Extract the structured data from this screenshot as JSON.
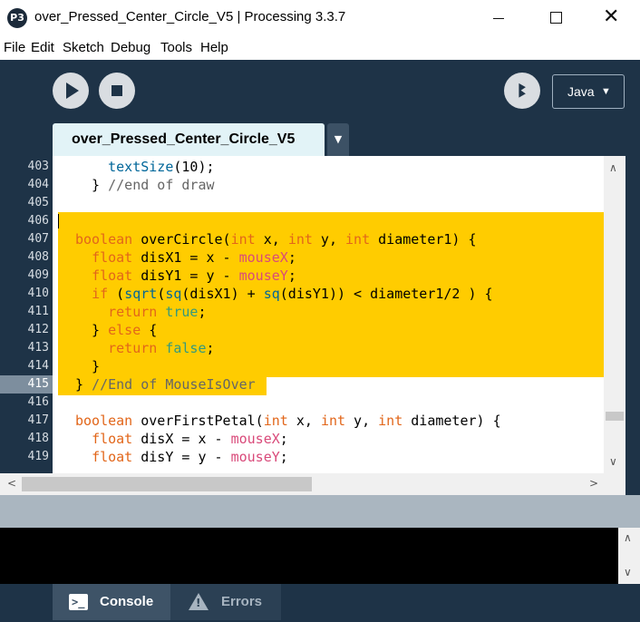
{
  "window": {
    "title": "over_Pressed_Center_Circle_V5 | Processing 3.3.7",
    "app_icon_text": "P3",
    "close_symbol": "✕"
  },
  "menu": {
    "items": [
      {
        "label": "File"
      },
      {
        "label": "Edit"
      },
      {
        "label": "Sketch"
      },
      {
        "label": "Debug"
      },
      {
        "label": "Tools"
      },
      {
        "label": "Help"
      }
    ]
  },
  "toolbar": {
    "run_icon": "play-icon",
    "stop_icon": "stop-icon",
    "debug_icon": "butterfly-debugger-icon",
    "debug_glyph": "ꔪ",
    "mode_label": "Java",
    "mode_arrow": "▼"
  },
  "tabs": {
    "active_label": "over_Pressed_Center_Circle_V5",
    "menu_arrow": "▼"
  },
  "editor": {
    "current_line": "415",
    "lines": [
      {
        "num": "403",
        "tokens": [
          {
            "t": "    ",
            "c": "plain"
          },
          {
            "t": "textSize",
            "c": "fn"
          },
          {
            "t": "(10);",
            "c": "plain"
          }
        ]
      },
      {
        "num": "404",
        "tokens": [
          {
            "t": "  } ",
            "c": "plain"
          },
          {
            "t": "//end of draw",
            "c": "cmt"
          }
        ]
      },
      {
        "num": "405",
        "tokens": []
      },
      {
        "num": "406",
        "tokens": []
      },
      {
        "num": "407",
        "tokens": [
          {
            "t": "boolean",
            "c": "kw"
          },
          {
            "t": " overCircle(",
            "c": "plain"
          },
          {
            "t": "int",
            "c": "kw"
          },
          {
            "t": " x, ",
            "c": "plain"
          },
          {
            "t": "int",
            "c": "kw"
          },
          {
            "t": " y, ",
            "c": "plain"
          },
          {
            "t": "int",
            "c": "kw"
          },
          {
            "t": " diameter1) {",
            "c": "plain"
          }
        ]
      },
      {
        "num": "408",
        "tokens": [
          {
            "t": "  ",
            "c": "plain"
          },
          {
            "t": "float",
            "c": "kw"
          },
          {
            "t": " disX1 = x - ",
            "c": "plain"
          },
          {
            "t": "mouseX",
            "c": "var"
          },
          {
            "t": ";",
            "c": "plain"
          }
        ]
      },
      {
        "num": "409",
        "tokens": [
          {
            "t": "  ",
            "c": "plain"
          },
          {
            "t": "float",
            "c": "kw"
          },
          {
            "t": " disY1 = y - ",
            "c": "plain"
          },
          {
            "t": "mouseY",
            "c": "var"
          },
          {
            "t": ";",
            "c": "plain"
          }
        ]
      },
      {
        "num": "410",
        "tokens": [
          {
            "t": "  ",
            "c": "plain"
          },
          {
            "t": "if",
            "c": "kw"
          },
          {
            "t": " (",
            "c": "plain"
          },
          {
            "t": "sqrt",
            "c": "fn"
          },
          {
            "t": "(",
            "c": "plain"
          },
          {
            "t": "sq",
            "c": "fn"
          },
          {
            "t": "(disX1) + ",
            "c": "plain"
          },
          {
            "t": "sq",
            "c": "fn"
          },
          {
            "t": "(disY1)) < diameter1/2 ) {",
            "c": "plain"
          }
        ]
      },
      {
        "num": "411",
        "tokens": [
          {
            "t": "    ",
            "c": "plain"
          },
          {
            "t": "return",
            "c": "kw"
          },
          {
            "t": " ",
            "c": "plain"
          },
          {
            "t": "true",
            "c": "lit"
          },
          {
            "t": ";",
            "c": "plain"
          }
        ]
      },
      {
        "num": "412",
        "tokens": [
          {
            "t": "  } ",
            "c": "plain"
          },
          {
            "t": "else",
            "c": "kw"
          },
          {
            "t": " {",
            "c": "plain"
          }
        ]
      },
      {
        "num": "413",
        "tokens": [
          {
            "t": "    ",
            "c": "plain"
          },
          {
            "t": "return",
            "c": "kw"
          },
          {
            "t": " ",
            "c": "plain"
          },
          {
            "t": "false",
            "c": "lit"
          },
          {
            "t": ";",
            "c": "plain"
          }
        ]
      },
      {
        "num": "414",
        "tokens": [
          {
            "t": "  }",
            "c": "plain"
          }
        ]
      },
      {
        "num": "415",
        "tokens": [
          {
            "t": "} ",
            "c": "plain"
          },
          {
            "t": "//End of MouseIsOver",
            "c": "cmt"
          }
        ]
      },
      {
        "num": "416",
        "tokens": []
      },
      {
        "num": "417",
        "tokens": [
          {
            "t": "boolean",
            "c": "kw"
          },
          {
            "t": " overFirstPetal(",
            "c": "plain"
          },
          {
            "t": "int",
            "c": "kw"
          },
          {
            "t": " x, ",
            "c": "plain"
          },
          {
            "t": "int",
            "c": "kw"
          },
          {
            "t": " y, ",
            "c": "plain"
          },
          {
            "t": "int",
            "c": "kw"
          },
          {
            "t": " diameter) {",
            "c": "plain"
          }
        ]
      },
      {
        "num": "418",
        "tokens": [
          {
            "t": "  ",
            "c": "plain"
          },
          {
            "t": "float",
            "c": "kw"
          },
          {
            "t": " disX = x - ",
            "c": "plain"
          },
          {
            "t": "mouseX",
            "c": "var"
          },
          {
            "t": ";",
            "c": "plain"
          }
        ]
      },
      {
        "num": "419",
        "tokens": [
          {
            "t": "  ",
            "c": "plain"
          },
          {
            "t": "float",
            "c": "kw"
          },
          {
            "t": " disY = y - ",
            "c": "plain"
          },
          {
            "t": "mouseY",
            "c": "var"
          },
          {
            "t": ";",
            "c": "plain"
          }
        ]
      }
    ]
  },
  "scrollbars": {
    "up_arrow": "∧",
    "down_arrow": "∨",
    "left_arrow": "<",
    "right_arrow": ">"
  },
  "footer": {
    "console_label": "Console",
    "errors_label": "Errors",
    "console_icon": "console-icon",
    "errors_icon": "warning-icon",
    "console_prompt": ">_",
    "warn_mark": "!"
  },
  "colors": {
    "toolbar_bg": "#1e3347",
    "highlight": "#ffcc00",
    "keyword": "#e2661a",
    "function": "#006699",
    "literal": "#33997e",
    "variable": "#d94a7a",
    "comment": "#666666"
  }
}
